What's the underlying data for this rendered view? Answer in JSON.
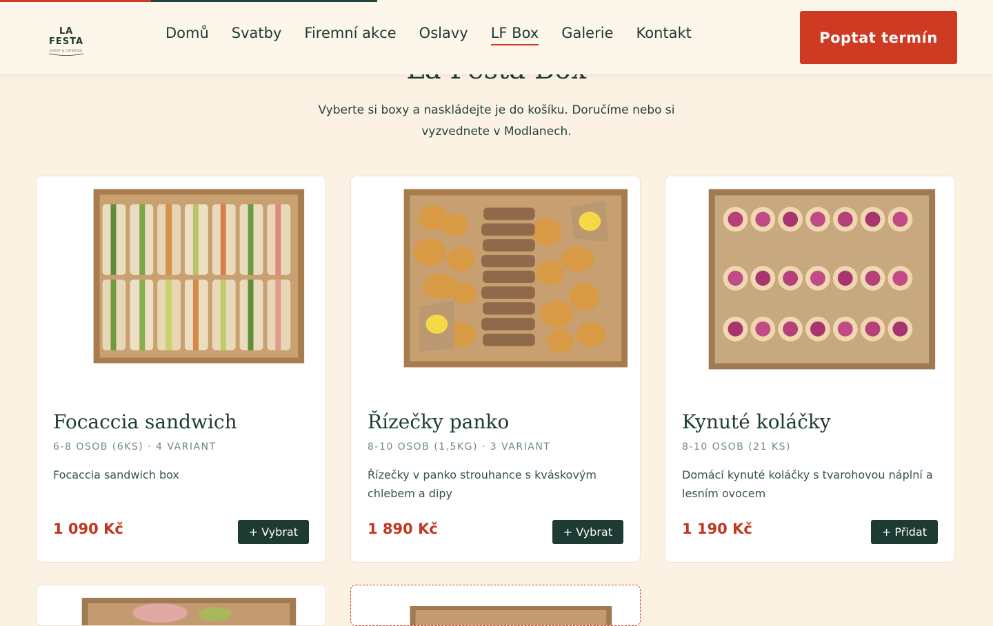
{
  "header": {
    "logo_text": "LA FESTA",
    "logo_tagline": "EVENT & CATERING",
    "nav": [
      {
        "label": "Domů"
      },
      {
        "label": "Svatby"
      },
      {
        "label": "Firemní akce"
      },
      {
        "label": "Oslavy"
      },
      {
        "label": "LF Box",
        "active": true
      },
      {
        "label": "Galerie"
      },
      {
        "label": "Kontakt"
      }
    ],
    "cta_label": "Poptat termín"
  },
  "hero": {
    "title": "La Festa Box",
    "intro_line1": "Vyberte si boxy a naskládejte je do košíku. Doručíme nebo si",
    "intro_line2": "vyzvednete v Modlanech."
  },
  "products": [
    {
      "title": "Focaccia sandwich",
      "meta": "6-8 OSOB (6KS) · 4 VARIANT",
      "description": "Focaccia sandwich box",
      "price": "1 090 Kč",
      "button": "+ Vybrat",
      "image": "sandwich-box-photo"
    },
    {
      "title": "Řízečky panko",
      "meta": "8-10 OSOB (1,5KG) · 3 VARIANT",
      "description": "Řízečky v panko strouhance s kváskovým chlebem a dipy",
      "price": "1 890 Kč",
      "button": "+ Vybrat",
      "image": "schnitzel-box-photo"
    },
    {
      "title": "Kynuté koláčky",
      "meta": "8-10 OSOB (21 KS)",
      "description": "Domácí kynuté koláčky s tvarohovou náplní a lesním ovocem",
      "price": "1 190 Kč",
      "button": "+ Přidat",
      "image": "kolache-box-photo"
    }
  ],
  "colors": {
    "background": "#fbf2e4",
    "accent": "#cf3a22",
    "dark_green": "#1d3a33"
  },
  "scroll_progress": 0.38
}
